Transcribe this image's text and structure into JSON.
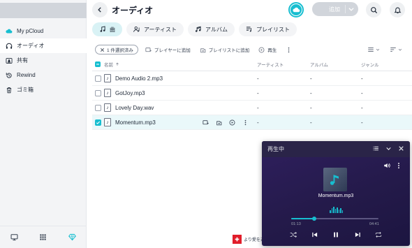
{
  "header": {
    "title": "オーディオ",
    "add_label": "追加"
  },
  "sidebar": {
    "items": [
      {
        "label": "My pCloud",
        "icon": "cloud-icon"
      },
      {
        "label": "オーディオ",
        "icon": "headphones-icon",
        "active": true
      },
      {
        "label": "共有",
        "icon": "shared-icon"
      },
      {
        "label": "Rewind",
        "icon": "rewind-icon"
      },
      {
        "label": "ゴミ箱",
        "icon": "trash-icon"
      }
    ],
    "bottom_icons": [
      "monitor-icon",
      "apps-grid-icon",
      "diamond-icon"
    ]
  },
  "tabs": [
    {
      "label": "曲",
      "icon": "music-note-icon",
      "active": true
    },
    {
      "label": "アーティスト",
      "icon": "artist-icon"
    },
    {
      "label": "アルバム",
      "icon": "album-icon"
    },
    {
      "label": "プレイリスト",
      "icon": "playlist-icon"
    }
  ],
  "action_bar": {
    "selection_chip": "1 件選択済み",
    "add_to_player": "プレイヤーに追加",
    "add_to_playlist": "プレイリストに追加",
    "play": "再生"
  },
  "table": {
    "columns": {
      "name": "名前",
      "artist": "アーティスト",
      "album": "アルバム",
      "genre": "ジャンル"
    },
    "rows": [
      {
        "name": "Demo Audio 2.mp3",
        "artist": "-",
        "album": "-",
        "genre": "-",
        "selected": false
      },
      {
        "name": "GotJoy.mp3",
        "artist": "-",
        "album": "-",
        "genre": "-",
        "selected": false
      },
      {
        "name": "Lovely Day.wav",
        "artist": "-",
        "album": "-",
        "genre": "-",
        "selected": false
      },
      {
        "name": "Momentum.mp3",
        "artist": "-",
        "album": "-",
        "genre": "-",
        "selected": true
      }
    ]
  },
  "footer": {
    "swiss_text": "より愛を込"
  },
  "player": {
    "title": "再生中",
    "track": "Momentum.mp3",
    "current_time": "01:13",
    "total_time": "04:41",
    "progress": 0.26
  },
  "colors": {
    "accent": "#17bed0",
    "player_bg": "#241a4a"
  }
}
